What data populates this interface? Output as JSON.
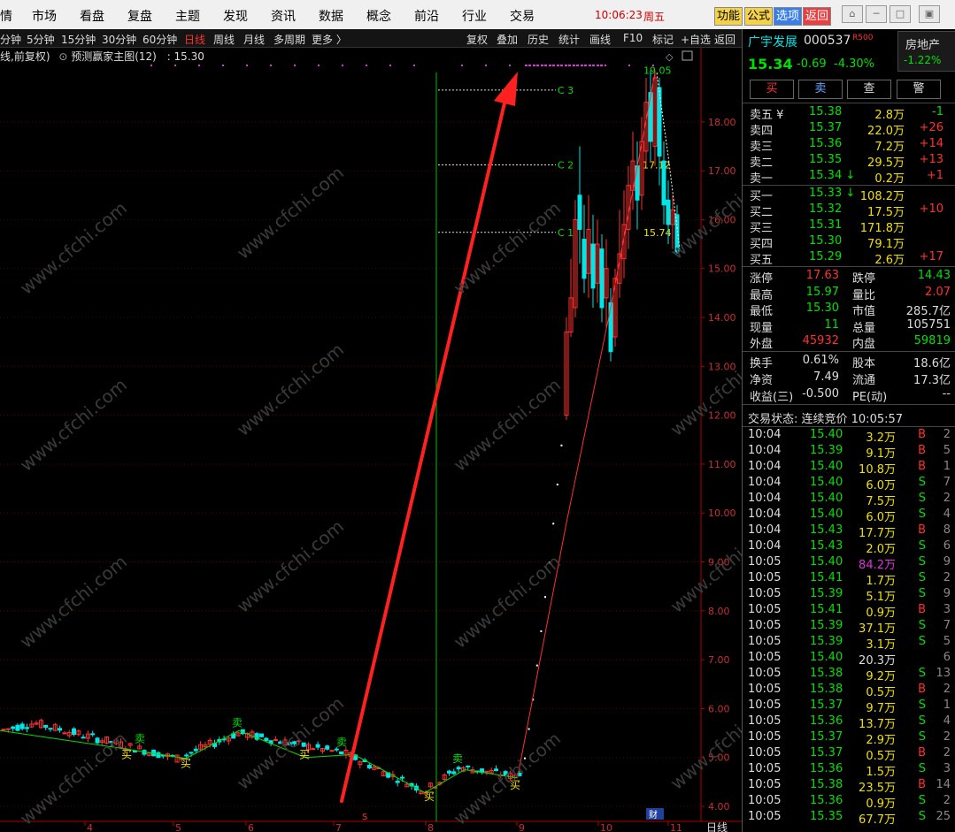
{
  "menu": {
    "items": [
      "情",
      "市场",
      "看盘",
      "复盘",
      "主题",
      "发现",
      "资讯",
      "数据",
      "概念",
      "前沿",
      "行业",
      "交易"
    ],
    "clock": "10:06:23",
    "weekday": "周五",
    "buttons": [
      "功能",
      "公式",
      "选项",
      "返回"
    ]
  },
  "periods": {
    "items": [
      "分钟",
      "5分钟",
      "15分钟",
      "30分钟",
      "60分钟",
      "日线",
      "周线",
      "月线",
      "多周期",
      "更多 〉"
    ],
    "active": "日线",
    "tools": [
      "复权",
      "叠加",
      "历史",
      "统计",
      "画线",
      "F10",
      "标记",
      "+自选",
      "返回"
    ]
  },
  "indicator_line": {
    "prefix": "线,前复权)",
    "name": "预测赢家主图(12)",
    "value": ": 15.30"
  },
  "chart_data": {
    "type": "candlestick",
    "period": "日线",
    "ylim": [
      4.0,
      19.0
    ],
    "y_ticks": [
      "18.00",
      "17.00",
      "16.00",
      "15.00",
      "14.00",
      "13.00",
      "12.00",
      "11.00",
      "10.00",
      "9.00",
      "8.00",
      "7.00",
      "6.00",
      "5.00",
      "4.00"
    ],
    "x_ticks": [
      "4",
      "5",
      "6",
      "7",
      "8",
      "9",
      "10",
      "11"
    ],
    "x_unit_label": "日线",
    "level_lines": [
      {
        "label": "C 3",
        "value": 18.65
      },
      {
        "label": "C 2",
        "value": 17.12
      },
      {
        "label": "C 1",
        "value": 15.74
      }
    ],
    "annotations": [
      "19.05",
      "17.12",
      "15.74"
    ],
    "signals": {
      "buy": "买",
      "sell": "卖",
      "small_tag": "S",
      "bottom_tag": "财"
    },
    "colors": {
      "up": "#ff3030",
      "down": "#00e5e5",
      "ma": "#ff3030",
      "trend": "#00e000",
      "levels": "#00e000",
      "arrow": "#ff2020"
    }
  },
  "quote": {
    "name": "广宇发展",
    "code": "000537",
    "r_tag": "R500",
    "sector": "房地产",
    "sector_change": "-1.22%",
    "price": "15.34",
    "change": "-0.69",
    "change_pct": "-4.30%",
    "actions": [
      "买",
      "卖",
      "查",
      "警"
    ],
    "asks": [
      {
        "label": "卖五 ¥",
        "price": "15.38",
        "vol": "2.8万",
        "diff": "-1"
      },
      {
        "label": "卖四",
        "price": "15.37",
        "vol": "22.0万",
        "diff": "+26"
      },
      {
        "label": "卖三",
        "price": "15.36",
        "vol": "7.2万",
        "diff": "+14"
      },
      {
        "label": "卖二",
        "price": "15.35",
        "vol": "29.5万",
        "diff": "+13"
      },
      {
        "label": "卖一",
        "price": "15.34 ↓",
        "vol": "0.2万",
        "diff": "+1"
      }
    ],
    "bids": [
      {
        "label": "买一",
        "price": "15.33 ↓",
        "vol": "108.2万",
        "diff": ""
      },
      {
        "label": "买二",
        "price": "15.32",
        "vol": "17.5万",
        "diff": "+10"
      },
      {
        "label": "买三",
        "price": "15.31",
        "vol": "171.8万",
        "diff": ""
      },
      {
        "label": "买四",
        "price": "15.30",
        "vol": "79.1万",
        "diff": ""
      },
      {
        "label": "买五",
        "price": "15.29",
        "vol": "2.6万",
        "diff": "+17"
      }
    ],
    "stats": [
      {
        "l1": "涨停",
        "v1": "17.63",
        "l2": "跌停",
        "v2": "14.43"
      },
      {
        "l1": "最高",
        "v1": "15.97",
        "l2": "量比",
        "v2": "2.07"
      },
      {
        "l1": "最低",
        "v1": "15.30",
        "l2": "市值",
        "v2": "285.7亿"
      },
      {
        "l1": "现量",
        "v1": "11",
        "l2": "总量",
        "v2": "105751"
      },
      {
        "l1": "外盘",
        "v1": "45932",
        "l2": "内盘",
        "v2": "59819"
      }
    ],
    "fundamentals": [
      {
        "l1": "换手",
        "v1": "0.61%",
        "l2": "股本",
        "v2": "18.6亿"
      },
      {
        "l1": "净资",
        "v1": "7.49",
        "l2": "流通",
        "v2": "17.3亿"
      },
      {
        "l1": "收益(三)",
        "v1": "-0.500",
        "l2": "PE(动)",
        "v2": "--"
      }
    ],
    "trade_status": "交易状态: 连续竞价 10:05:57",
    "ticks": [
      {
        "t": "10:04",
        "p": "15.40",
        "v": "3.2万",
        "s": "B",
        "n": "2"
      },
      {
        "t": "10:04",
        "p": "15.39",
        "v": "9.1万",
        "s": "B",
        "n": "5"
      },
      {
        "t": "10:04",
        "p": "15.40",
        "v": "10.8万",
        "s": "B",
        "n": "1"
      },
      {
        "t": "10:04",
        "p": "15.40",
        "v": "6.0万",
        "s": "S",
        "n": "7"
      },
      {
        "t": "10:04",
        "p": "15.40",
        "v": "7.5万",
        "s": "S",
        "n": "2"
      },
      {
        "t": "10:04",
        "p": "15.40",
        "v": "6.0万",
        "s": "S",
        "n": "4"
      },
      {
        "t": "10:04",
        "p": "15.43",
        "v": "17.7万",
        "s": "B",
        "n": "8"
      },
      {
        "t": "10:04",
        "p": "15.43",
        "v": "2.0万",
        "s": "S",
        "n": "6"
      },
      {
        "t": "10:05",
        "p": "15.40",
        "v": "84.2万",
        "s": "S",
        "n": "9"
      },
      {
        "t": "10:05",
        "p": "15.41",
        "v": "1.7万",
        "s": "S",
        "n": "2"
      },
      {
        "t": "10:05",
        "p": "15.39",
        "v": "5.1万",
        "s": "S",
        "n": "9"
      },
      {
        "t": "10:05",
        "p": "15.41",
        "v": "0.9万",
        "s": "B",
        "n": "3"
      },
      {
        "t": "10:05",
        "p": "15.39",
        "v": "37.1万",
        "s": "S",
        "n": "7"
      },
      {
        "t": "10:05",
        "p": "15.39",
        "v": "3.1万",
        "s": "S",
        "n": "5"
      },
      {
        "t": "10:05",
        "p": "15.40",
        "v": "20.3万",
        "s": "",
        "n": "6"
      },
      {
        "t": "10:05",
        "p": "15.38",
        "v": "9.2万",
        "s": "S",
        "n": "13"
      },
      {
        "t": "10:05",
        "p": "15.38",
        "v": "0.5万",
        "s": "B",
        "n": "2"
      },
      {
        "t": "10:05",
        "p": "15.37",
        "v": "9.7万",
        "s": "S",
        "n": "1"
      },
      {
        "t": "10:05",
        "p": "15.36",
        "v": "13.7万",
        "s": "S",
        "n": "4"
      },
      {
        "t": "10:05",
        "p": "15.37",
        "v": "2.9万",
        "s": "S",
        "n": "2"
      },
      {
        "t": "10:05",
        "p": "15.37",
        "v": "0.5万",
        "s": "B",
        "n": "2"
      },
      {
        "t": "10:05",
        "p": "15.36",
        "v": "1.5万",
        "s": "S",
        "n": "3"
      },
      {
        "t": "10:05",
        "p": "15.38",
        "v": "23.5万",
        "s": "B",
        "n": "14"
      },
      {
        "t": "10:05",
        "p": "15.36",
        "v": "0.9万",
        "s": "S",
        "n": "2"
      },
      {
        "t": "10:05",
        "p": "15.35",
        "v": "67.7万",
        "s": "S",
        "n": "25"
      }
    ]
  },
  "watermark": "www.cfchi.com"
}
